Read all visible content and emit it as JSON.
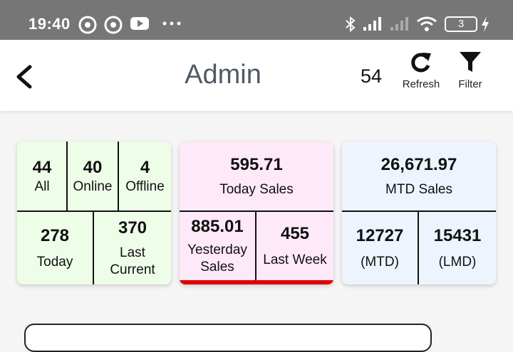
{
  "status_bar": {
    "time": "19:40",
    "battery": "3"
  },
  "app_bar": {
    "title": "Admin",
    "count": "54",
    "refresh_label": "Refresh",
    "filter_label": "Filter"
  },
  "devices_card": {
    "all_value": "44",
    "all_label": "All",
    "online_value": "40",
    "online_label": "Online",
    "offline_value": "4",
    "offline_label": "Offline",
    "today_value": "278",
    "today_label": "Today",
    "last_current_value": "370",
    "last_current_label_1": "Last",
    "last_current_label_2": "Current",
    "bg": "#eefde8"
  },
  "sales_card": {
    "today_value": "595.71",
    "today_label": "Today Sales",
    "yesterday_value": "885.01",
    "yesterday_label_1": "Yesterday",
    "yesterday_label_2": "Sales",
    "last_week_value": "455",
    "last_week_label": "Last Week",
    "bg": "#fde9f7",
    "accent": "#e00000"
  },
  "mtd_card": {
    "mtd_sales_value": "26,671.97",
    "mtd_sales_label": "MTD Sales",
    "mtd_value": "12727",
    "mtd_label": "(MTD)",
    "lmd_value": "15431",
    "lmd_label": "(LMD)",
    "bg": "#edf4fe"
  }
}
